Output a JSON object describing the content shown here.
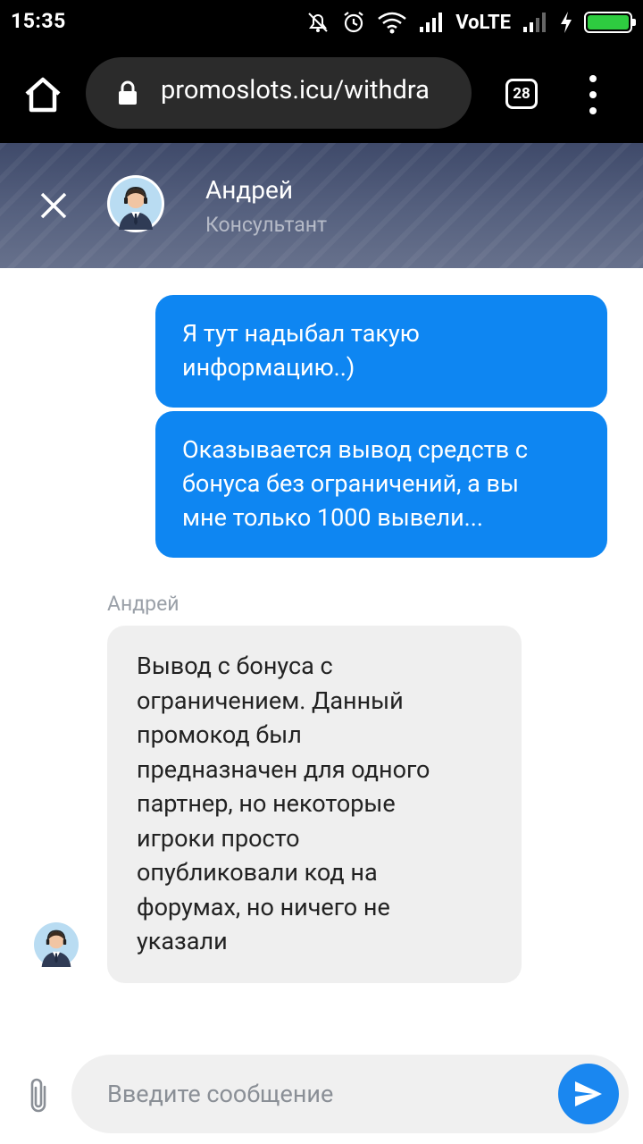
{
  "status_bar": {
    "time": "15:35",
    "network_label": "VoLTE",
    "icons": [
      "mute-icon",
      "alarm-icon",
      "wifi-icon",
      "signal-icon",
      "signal-2-icon",
      "charging-icon",
      "battery-icon"
    ],
    "battery_level": 1.0
  },
  "browser": {
    "url": "promoslots.icu/withdra",
    "tab_count": "28",
    "icons": [
      "home-icon",
      "lock-icon",
      "more-vert-icon"
    ]
  },
  "chat_header": {
    "name": "Андрей",
    "role": "Консультант",
    "icons": [
      "close-icon",
      "consultant-avatar"
    ]
  },
  "messages": {
    "outgoing": [
      {
        "lines": [
          "Я тут надыбал такую",
          "информацию..)"
        ]
      },
      {
        "lines": [
          "Оказывается вывод средств с",
          "бонуса без ограничений, а вы",
          "мне только 1000 вывели..."
        ]
      }
    ],
    "incoming": {
      "sender": "Андрей",
      "lines": [
        "Вывод с бонуса с",
        "ограничением. Данный",
        "промокод был",
        "предназначен для одного",
        "партнер, но некоторые",
        "игроки просто",
        "опубликовали код на",
        "форумах, но ничего не",
        "указали"
      ]
    }
  },
  "composer": {
    "placeholder": "Введите сообщение",
    "icons": [
      "paperclip-icon",
      "send-icon"
    ]
  },
  "colors": {
    "outgoing_bubble": "#0e86f2",
    "incoming_bubble": "#efefef",
    "header_bg": "#56617f",
    "send_button": "#1a87f0"
  }
}
